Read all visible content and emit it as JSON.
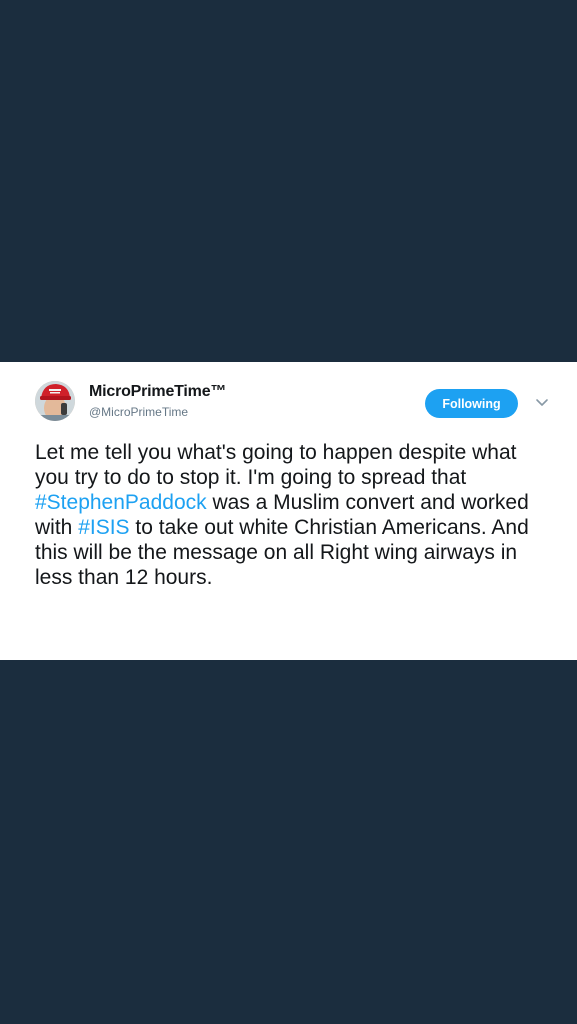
{
  "tweet": {
    "display_name": "MicroPrimeTime™",
    "handle": "@MicroPrimeTime",
    "follow_button_label": "Following",
    "text_parts": {
      "p1": "Let me tell you what's going to happen despite what you try to do to stop it. I'm going to spread that ",
      "hashtag1": "#StephenPaddock",
      "p2": " was a Muslim convert and worked with ",
      "hashtag2": "#ISIS",
      "p3": " to take out white Christian Americans. And this will be the message on all Right wing airways in less than 12 hours."
    }
  },
  "icons": {
    "avatar": "profile-avatar",
    "menu": "chevron-down-icon"
  },
  "colors": {
    "background": "#1b2d3e",
    "card": "#ffffff",
    "accent": "#1da1f2",
    "text": "#14171a",
    "muted": "#657786"
  }
}
